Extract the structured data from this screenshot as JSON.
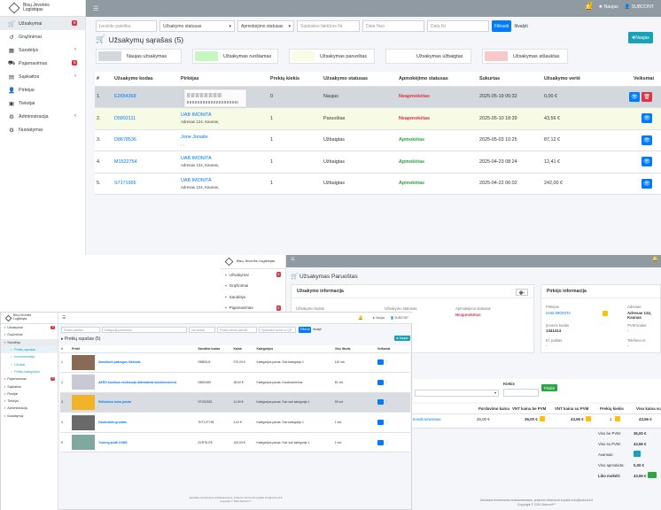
{
  "main": {
    "brand": "Bisų Jėvonės Logistiqas",
    "sidebar": [
      {
        "label": "Užsakymai",
        "icon": "cart-icon",
        "badge": "8"
      },
      {
        "label": "Grąžinimai",
        "icon": "return-icon"
      },
      {
        "label": "Sandėlys",
        "icon": "warehouse-icon"
      },
      {
        "label": "Pajamavimas",
        "icon": "truck-icon",
        "badge": "8"
      },
      {
        "label": "Sąskaitos",
        "icon": "invoice-icon"
      },
      {
        "label": "Pirkėjai",
        "icon": "user-icon"
      },
      {
        "label": "Tiekėjai",
        "icon": "supplier-icon"
      },
      {
        "label": "Administracija",
        "icon": "admin-icon"
      },
      {
        "label": "Nustatymai",
        "icon": "gear-icon"
      }
    ],
    "navbar": {
      "bell_count": "1",
      "new_label": "Naujas",
      "user": "SUBCONT"
    },
    "filters": {
      "search": "Įveskite paieška",
      "order_status": "Užsakymo statusas",
      "payment_status": "Apmokėjimo statusas",
      "invoice_no": "Sąskaitos faktūros Nr.",
      "date_from": "Data Nuo",
      "date_to": "Data Iki",
      "filter_btn": "Filtruoti",
      "reset": "Išvalyti"
    },
    "title": "Užsakymų sąrašas (5)",
    "new_button": "Naujas",
    "legend": [
      {
        "label": "Naujas užsakymas",
        "color": "#d3d8dd"
      },
      {
        "label": "Užsakymas ruošiamas",
        "color": "#c7f7c0"
      },
      {
        "label": "Užsakymas paruoštas",
        "color": "#fafbe3"
      },
      {
        "label": "Užsakymas užbaigtas",
        "color": "#ffffff"
      },
      {
        "label": "Užsakymas atšauktas",
        "color": "#f8c8cb"
      }
    ],
    "table": {
      "headers": [
        "#",
        "Užsakymo kodas",
        "Pirkėjas",
        "Prekių kiekis",
        "Užsakymo statusas",
        "Apmokėjimo statusas",
        "Sukurtas",
        "Užsakymo vertė",
        "Veiksmai"
      ],
      "rows": [
        {
          "n": "1.",
          "code": "E2654368",
          "buyer": "",
          "address": "",
          "qty": "0",
          "status": "Naujas",
          "payment": "Neapmokėtas",
          "created": "2025-05-19 05:32",
          "value": "0,00 €"
        },
        {
          "n": "2.",
          "code": "D5892111",
          "buyer": "UAB IMONITA",
          "address": "Adresas 124, Kaunas,",
          "qty": "1",
          "status": "Paruoštas",
          "payment": "Neapmokėtas",
          "created": "2025-05-10 18:39",
          "value": "43,56 €"
        },
        {
          "n": "3.",
          "code": "D8678536",
          "buyer": "Jone Jonaite",
          "address": ", ,",
          "qty": "1",
          "status": "Užbaigtas",
          "payment": "Apmokėtas",
          "created": "2025-05-03 10:25",
          "value": "87,12 €"
        },
        {
          "n": "4.",
          "code": "M1522754",
          "buyer": "UAB IMONITA",
          "address": "Adresas 124, Kaunas,",
          "qty": "1",
          "status": "Užbaigtas",
          "payment": "Apmokėtas",
          "created": "2025-04-23 08:24",
          "value": "12,41 €"
        },
        {
          "n": "5.",
          "code": "S7171965",
          "buyer": "UAB IMONITA",
          "address": "Adresas 124, Kaunas,",
          "qty": "1",
          "status": "Užbaigtas",
          "payment": "Apmokėtas",
          "created": "2025-04-22 06:02",
          "value": "242,00 €"
        }
      ]
    }
  },
  "order_view": {
    "brand": "Bisų Jėvonės Logistiqas",
    "sidebar": [
      {
        "label": "Užsakymai",
        "badge": "8"
      },
      {
        "label": "Grąžinimai"
      },
      {
        "label": "Sandėlys"
      },
      {
        "label": "Pajamavimas",
        "badge": "8"
      }
    ],
    "title": "Užsakymas Paruoštas",
    "info_header": "Užsakymo informacija",
    "buyer_header": "Pirkėjo informacija",
    "order_code_label": "Užsakymo kodas",
    "order_status_label": "Užsakymo statusas",
    "payment_status_label": "Apmokėjimo statusas",
    "payment_status_value": "Neapmokėtas",
    "buyer_label": "Pirkėjas",
    "buyer_value": "UAB IMONITA",
    "address_label": "Adresas",
    "address_value": "Adresas 124, Kaunas",
    "company_code_label": "Įmonės kodas",
    "company_code_value": "1341414",
    "vat_label": "PVM kodas",
    "vat_value": "-",
    "email_label": "El. paštas",
    "email_value": "-",
    "phone_label": "Telefono nr.",
    "phone_value": "-",
    "qty_label": "Kiekis",
    "add_button": "Pridėti",
    "items_headers": [
      "Pardavimo kaina",
      "VNT kaina be PVM",
      "VNT kaina su PVM",
      "Prekių kiekis",
      "Viso kaina su"
    ],
    "item": {
      "name": "kondicionieriaus",
      "price": "36,00 €",
      "unit_no_vat": "36,00 €",
      "unit_vat": "43,56 €",
      "qty": "1",
      "total": "43,56 €"
    },
    "summary": [
      {
        "label": "Viso be PVM:",
        "value": "36,00 €"
      },
      {
        "label": "Viso su PVM:",
        "value": "43,56 €"
      },
      {
        "label": "Avansas:",
        "value": ""
      },
      {
        "label": "Viso apmokėta:",
        "value": "0,00 €"
      },
      {
        "label": "Liko mokėti:",
        "value": "43,56 €"
      }
    ],
    "footer": "Atsiradus techniniams nesklandumams, prašome informuoti el.paštu info@subcont.lt\nCopyright © 2024 Subcont™"
  },
  "products": {
    "brand": "Bisų Jėvonės Logistiqas",
    "sidebar": [
      {
        "label": "Užsakymai",
        "badge": "8"
      },
      {
        "label": "Grąžinimai"
      },
      {
        "label": "Sandėlys"
      },
      {
        "label": "Prekių sąrašas",
        "sub": true,
        "active": true
      },
      {
        "label": "Inventorizacija",
        "sub": true
      },
      {
        "label": "Likučiai",
        "sub": true
      },
      {
        "label": "Prekių kategorijos",
        "sub": true
      },
      {
        "label": "Pajamavimas",
        "badge": "8"
      },
      {
        "label": "Sąskaitos"
      },
      {
        "label": "Pirkėjai"
      },
      {
        "label": "Tiekėjai"
      },
      {
        "label": "Administracija"
      },
      {
        "label": "Nustatymai"
      }
    ],
    "filters": [
      "Prekės paieška",
      "Kategorija parinkimas",
      "Visi kiekiai",
      "Prekės vienos parinkti",
      "Spausdinti kodus su QR"
    ],
    "filter_btn": "Filtruoti",
    "reset": "Išvalyti",
    "new_button": "Naujas",
    "title": "Prekių sąrašas (5)",
    "headers": [
      "#",
      "Prekė",
      "",
      "Sandėlio kodas",
      "Kaina",
      "Kategorijos",
      "Viso likutis",
      "Veiksmai"
    ],
    "rows": [
      {
        "n": "1",
        "name": "Ilmoštinės pakrogos liikinolis",
        "code": "SBB05J4",
        "price": "970,00 €",
        "cat": "Kategorijos pavas: Sub kategorija 1",
        "stock": "110 vnt.",
        "color": "#8a6a52"
      },
      {
        "n": "2",
        "name": "AERO kuolinuo esolinuoja didėstiantis kondicionierius",
        "code": "SBD0459",
        "price": "36,00 €",
        "cat": "Kategorijos pavas: Kondicionierius",
        "stock": "81 vnt.",
        "color": "#c9c9d6"
      },
      {
        "n": "3",
        "name": "Reiksiniso kuno juosta",
        "code": "ST0S25S1",
        "price": "11,00 €",
        "cat": "Kategorijos pavas: Sub sub kategorija 1",
        "stock": "99 vnt.",
        "color": "#f0b429"
      },
      {
        "n": "4",
        "name": "Kazdruktės gruntas",
        "code": "TKT12T7JB",
        "price": "3,41 €",
        "cat": "Kategorijos pavas: Sub kategorija 1",
        "stock": "1 vnt.",
        "color": "#6a6a6a"
      },
      {
        "n": "5",
        "name": "Tvoring protti XXMS",
        "code": "ZXRT5J78",
        "price": "100,00 €",
        "cat": "Kategorijos pavas: Sub sub kategorija 1",
        "stock": "1 vnt.",
        "color": "#7fa8a0"
      }
    ],
    "footer": "Atsiradus techniniams nesklandumams, prašome informuoti el.paštu info@subcont.lt\nCopyright © 2024 Subcont™"
  }
}
